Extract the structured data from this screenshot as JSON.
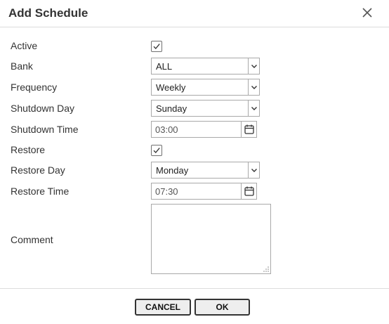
{
  "dialog": {
    "title": "Add Schedule"
  },
  "fields": {
    "active": {
      "label": "Active",
      "checked": true
    },
    "bank": {
      "label": "Bank",
      "value": "ALL"
    },
    "frequency": {
      "label": "Frequency",
      "value": "Weekly"
    },
    "shutdown_day": {
      "label": "Shutdown Day",
      "value": "Sunday"
    },
    "shutdown_time": {
      "label": "Shutdown Time",
      "value": "03:00"
    },
    "restore": {
      "label": "Restore",
      "checked": true
    },
    "restore_day": {
      "label": "Restore Day",
      "value": "Monday"
    },
    "restore_time": {
      "label": "Restore Time",
      "value": "07:30"
    },
    "comment": {
      "label": "Comment",
      "value": ""
    }
  },
  "buttons": {
    "cancel": "CANCEL",
    "ok": "OK"
  },
  "icons": {
    "close": "close-icon",
    "checkmark": "checkmark-icon",
    "dropdown": "chevron-down-icon",
    "calendar": "calendar-icon",
    "resize": "resize-grip-icon"
  },
  "colors": {
    "border": "#a9a9a9",
    "text": "#333333",
    "divider": "#dcdcdc"
  }
}
